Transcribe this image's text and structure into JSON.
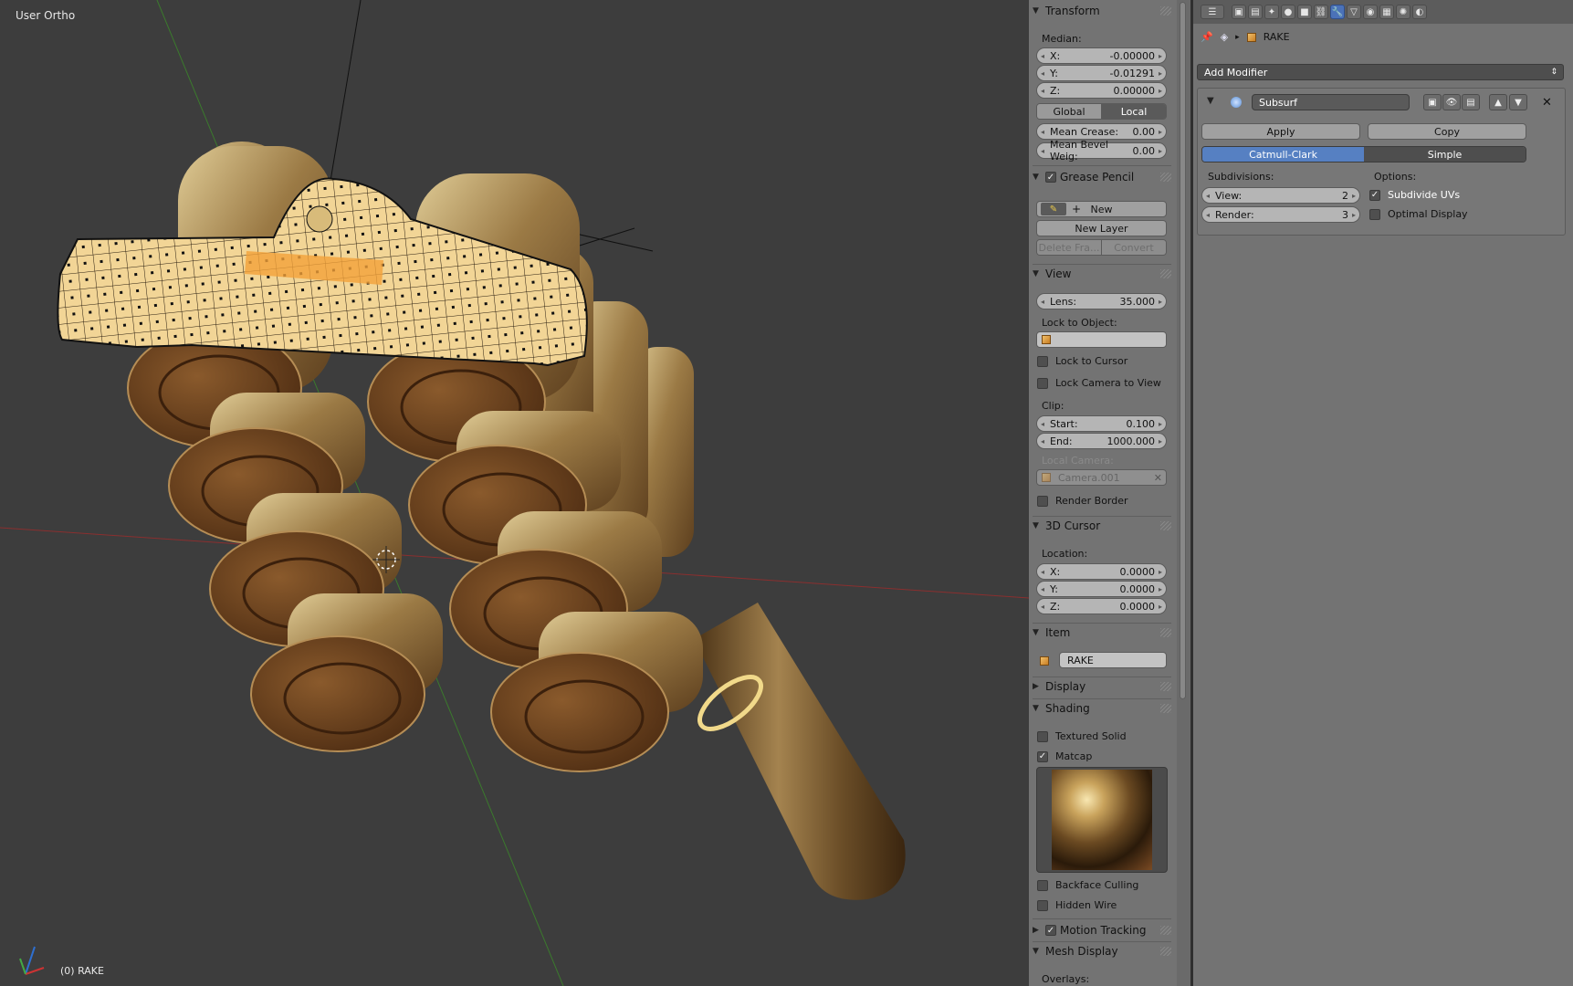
{
  "viewport": {
    "title": "User Ortho",
    "status": "(0) RAKE"
  },
  "npanel": {
    "transform": {
      "header": "Transform",
      "median_label": "Median:",
      "x_label": "X:",
      "x_value": "-0.00000",
      "y_label": "Y:",
      "y_value": "-0.01291",
      "z_label": "Z:",
      "z_value": "0.00000",
      "global_label": "Global",
      "local_label": "Local",
      "crease_label": "Mean Crease:",
      "crease_value": "0.00",
      "bevel_label": "Mean Bevel Weig:",
      "bevel_value": "0.00"
    },
    "grease_pencil": {
      "header": "Grease Pencil",
      "new_label": "New",
      "new_layer_label": "New Layer",
      "delete_frame_label": "Delete Fra...",
      "convert_label": "Convert"
    },
    "view": {
      "header": "View",
      "lens_label": "Lens:",
      "lens_value": "35.000",
      "lock_object_label": "Lock to Object:",
      "lock_cursor_label": "Lock to Cursor",
      "lock_camera_label": "Lock Camera to View",
      "clip_label": "Clip:",
      "start_label": "Start:",
      "start_value": "0.100",
      "end_label": "End:",
      "end_value": "1000.000",
      "local_camera_label": "Local Camera:",
      "local_camera_value": "Camera.001",
      "render_border_label": "Render Border"
    },
    "cursor": {
      "header": "3D Cursor",
      "location_label": "Location:",
      "x_label": "X:",
      "x_value": "0.0000",
      "y_label": "Y:",
      "y_value": "0.0000",
      "z_label": "Z:",
      "z_value": "0.0000"
    },
    "item": {
      "header": "Item",
      "name": "RAKE"
    },
    "display": {
      "header": "Display"
    },
    "shading": {
      "header": "Shading",
      "textured_solid_label": "Textured Solid",
      "matcap_label": "Matcap",
      "backface_label": "Backface Culling",
      "hidden_wire_label": "Hidden Wire"
    },
    "motion_tracking": {
      "header": "Motion Tracking"
    },
    "mesh_display": {
      "header": "Mesh Display",
      "overlays_label": "Overlays:"
    }
  },
  "props": {
    "breadcrumb_object": "RAKE",
    "add_modifier_label": "Add Modifier",
    "modifier": {
      "name": "Subsurf",
      "apply_label": "Apply",
      "copy_label": "Copy",
      "catmull_label": "Catmull-Clark",
      "simple_label": "Simple",
      "subdivisions_label": "Subdivisions:",
      "options_label": "Options:",
      "view_label": "View:",
      "view_value": "2",
      "render_label": "Render:",
      "render_value": "3",
      "subdivide_uvs_label": "Subdivide UVs",
      "optimal_display_label": "Optimal Display"
    }
  },
  "colors": {
    "viewport_bg": "#3d3d3d",
    "panel_bg": "#737373",
    "accent": "#5680c2",
    "selection": "#f3a13a"
  }
}
